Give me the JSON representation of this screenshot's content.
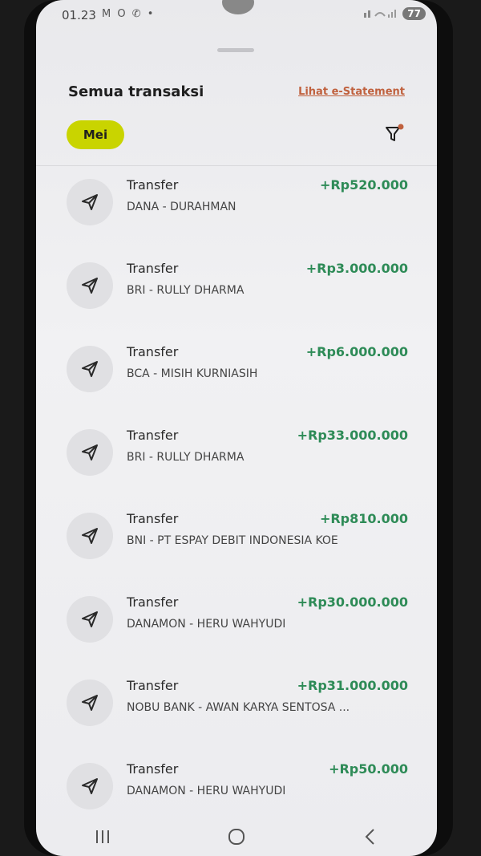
{
  "status": {
    "time": "01.23",
    "left_icons": "M O ✆ •",
    "battery": "77"
  },
  "header": {
    "title": "Semua transaksi",
    "estatement_label": "Lihat e-Statement"
  },
  "filter": {
    "month_chip": "Mei",
    "filter_icon": "filter-icon"
  },
  "colors": {
    "accent_chip": "#c9d400",
    "amount_positive": "#2e8b57",
    "link": "#c0613e"
  },
  "transactions": [
    {
      "type": "Transfer",
      "detail": "DANA - DURAHMAN",
      "amount": "+Rp520.000",
      "icon": "send-icon"
    },
    {
      "type": "Transfer",
      "detail": "BRI - RULLY DHARMA",
      "amount": "+Rp3.000.000",
      "icon": "send-icon"
    },
    {
      "type": "Transfer",
      "detail": "BCA - MISIH KURNIASIH",
      "amount": "+Rp6.000.000",
      "icon": "send-icon"
    },
    {
      "type": "Transfer",
      "detail": "BRI - RULLY DHARMA",
      "amount": "+Rp33.000.000",
      "icon": "send-icon"
    },
    {
      "type": "Transfer",
      "detail": "BNI - PT ESPAY DEBIT INDONESIA KOE",
      "amount": "+Rp810.000",
      "icon": "send-icon"
    },
    {
      "type": "Transfer",
      "detail": "DANAMON - HERU WAHYUDI",
      "amount": "+Rp30.000.000",
      "icon": "send-icon"
    },
    {
      "type": "Transfer",
      "detail": "NOBU BANK - AWAN KARYA SENTOSA ...",
      "amount": "+Rp31.000.000",
      "icon": "send-icon"
    },
    {
      "type": "Transfer",
      "detail": "DANAMON - HERU WAHYUDI",
      "amount": "+Rp50.000",
      "icon": "send-icon"
    }
  ],
  "navbar": {
    "recent_icon": "recent-apps-icon",
    "home_icon": "home-icon",
    "back_icon": "back-icon"
  }
}
